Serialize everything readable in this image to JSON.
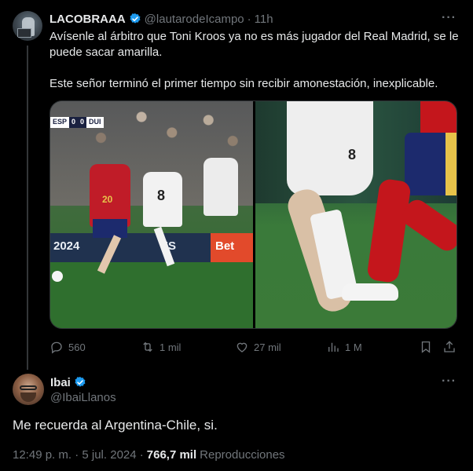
{
  "tweet": {
    "author_name": "LACOBRAAA",
    "author_handle": "@lautarodeIcampo",
    "separator": "·",
    "time": "11h",
    "text_p1": "Avísenle al árbitro que Toni Kroos ya no es más jugador del Real Madrid, se le puede sacar amarilla.",
    "text_p2": "Este señor terminó el primer tiempo sin recibir amonestación, inexplicable.",
    "media": {
      "scoreboard": [
        "ESP",
        "0",
        "0",
        "DUI"
      ],
      "board_text_left": "2024",
      "board_text_mid": "ES",
      "board_text_right": "Bet",
      "jersey_red_number": "20",
      "jersey_white_number": "8",
      "jersey_closeup_number": "8"
    },
    "stats": {
      "replies": "560",
      "reposts": "1 mil",
      "likes": "27 mil",
      "views": "1 M"
    },
    "icons": [
      "reply-icon",
      "repost-icon",
      "like-icon",
      "views-icon",
      "bookmark-icon",
      "share-icon"
    ],
    "more_label": "···"
  },
  "reply": {
    "author_name": "Ibai",
    "author_handle": "@IbaiLlanos",
    "text": "Me recuerda al Argentina-Chile, si.",
    "more_label": "···",
    "timestamp": "12:49 p. m. · 5 jul. 2024 ·",
    "views_count": "766,7 mil",
    "views_label": "Reproducciones"
  },
  "colors": {
    "background": "#000000",
    "text_primary": "#e7e9ea",
    "text_secondary": "#71767b",
    "verified_blue": "#1d9bf0"
  }
}
